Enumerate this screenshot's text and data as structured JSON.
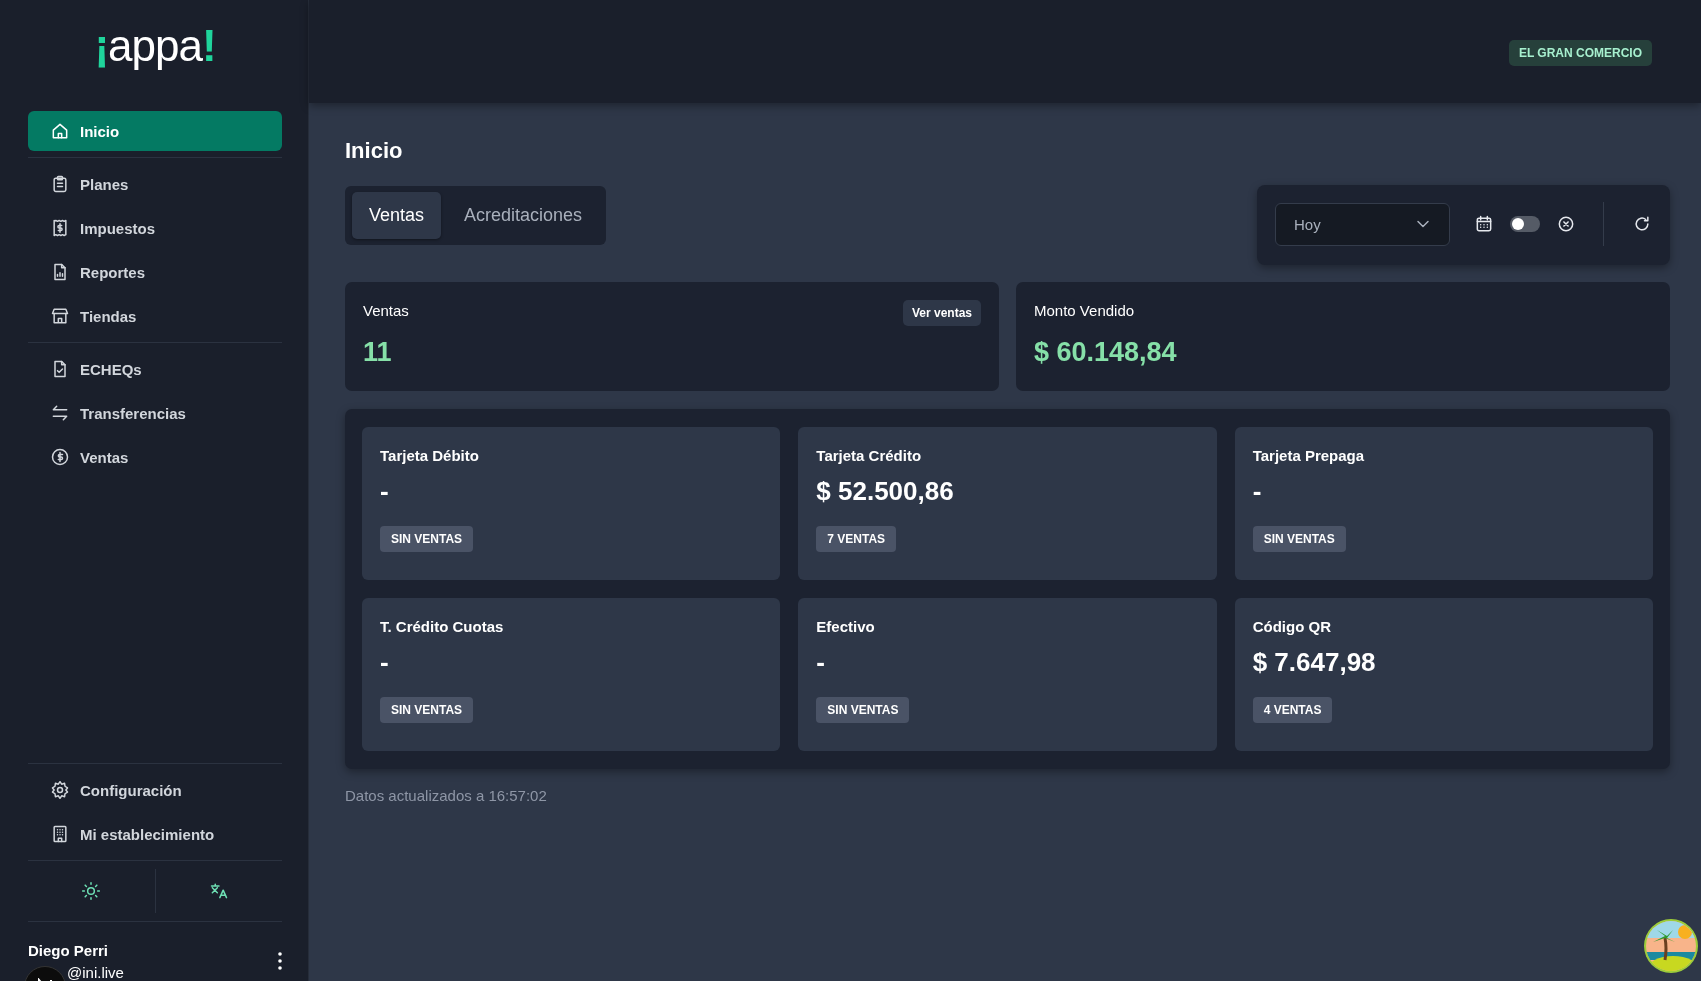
{
  "brand": {
    "lead": "¡",
    "word": "appa",
    "tail": "!"
  },
  "sidebar": {
    "groups": [
      [
        {
          "label": "Inicio",
          "selected": true
        }
      ],
      [
        {
          "label": "Planes",
          "selected": false
        },
        {
          "label": "Impuestos",
          "selected": false
        },
        {
          "label": "Reportes",
          "selected": false
        },
        {
          "label": "Tiendas",
          "selected": false
        }
      ],
      [
        {
          "label": "ECHEQs",
          "selected": false
        },
        {
          "label": "Transferencias",
          "selected": false
        },
        {
          "label": "Ventas",
          "selected": false
        }
      ]
    ],
    "bottom_items": [
      {
        "label": "Configuración",
        "selected": false
      },
      {
        "label": "Mi establecimiento",
        "selected": false
      }
    ],
    "user": {
      "name": "Diego Perri",
      "email": "@ini.live"
    }
  },
  "header": {
    "store_badge": "EL GRAN COMERCIO"
  },
  "page_title": "Inicio",
  "tabs": [
    {
      "label": "Ventas",
      "selected": true
    },
    {
      "label": "Acreditaciones",
      "selected": false
    }
  ],
  "filter": {
    "period": "Hoy",
    "toggle_on": false
  },
  "summary_cards": [
    {
      "title": "Ventas",
      "value": "11",
      "action": "Ver ventas"
    },
    {
      "title": "Monto Vendido",
      "value": "$ 60.148,84"
    }
  ],
  "methods": [
    {
      "title": "Tarjeta Débito",
      "amount": "-",
      "badge": "SIN VENTAS"
    },
    {
      "title": "Tarjeta Crédito",
      "amount": "$ 52.500,86",
      "badge": "7 VENTAS"
    },
    {
      "title": "Tarjeta Prepaga",
      "amount": "-",
      "badge": "SIN VENTAS"
    },
    {
      "title": "T. Crédito Cuotas",
      "amount": "-",
      "badge": "SIN VENTAS"
    },
    {
      "title": "Efectivo",
      "amount": "-",
      "badge": "SIN VENTAS"
    },
    {
      "title": "Código QR",
      "amount": "$ 7.647,98",
      "badge": "4 VENTAS"
    }
  ],
  "footer": "Datos actualizados a 16:57:02"
}
